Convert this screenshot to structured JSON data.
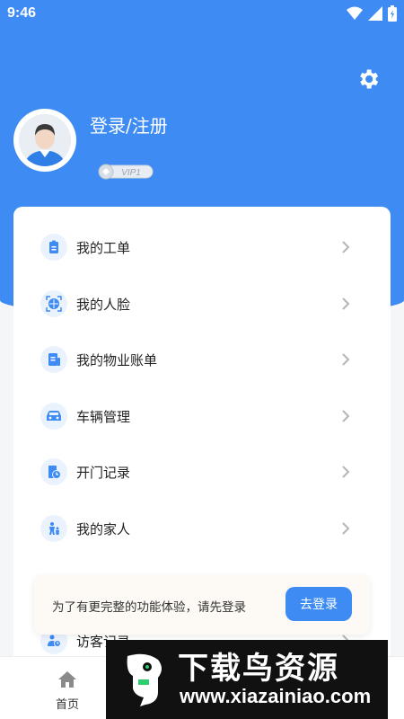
{
  "status_bar": {
    "time": "9:46"
  },
  "profile": {
    "login_label": "登录/注册",
    "vip_badge": "VIP1"
  },
  "menu": [
    {
      "label": "我的工单",
      "icon": "clipboard-icon"
    },
    {
      "label": "我的人脸",
      "icon": "face-scan-icon"
    },
    {
      "label": "我的物业账单",
      "icon": "bill-icon"
    },
    {
      "label": "车辆管理",
      "icon": "car-icon"
    },
    {
      "label": "开门记录",
      "icon": "door-record-icon"
    },
    {
      "label": "我的家人",
      "icon": "family-icon"
    },
    {
      "label": "访客记录",
      "icon": "visitor-icon"
    }
  ],
  "toast": {
    "message": "为了有更完整的功能体验，请先登录",
    "button_label": "去登录"
  },
  "tabbar": {
    "home_label": "首页"
  },
  "watermark": {
    "title": "下载鸟资源",
    "url": "www.xiazainiao.com"
  },
  "colors": {
    "primary": "#3d8bf3",
    "icon_bg": "#eaf2fe"
  }
}
